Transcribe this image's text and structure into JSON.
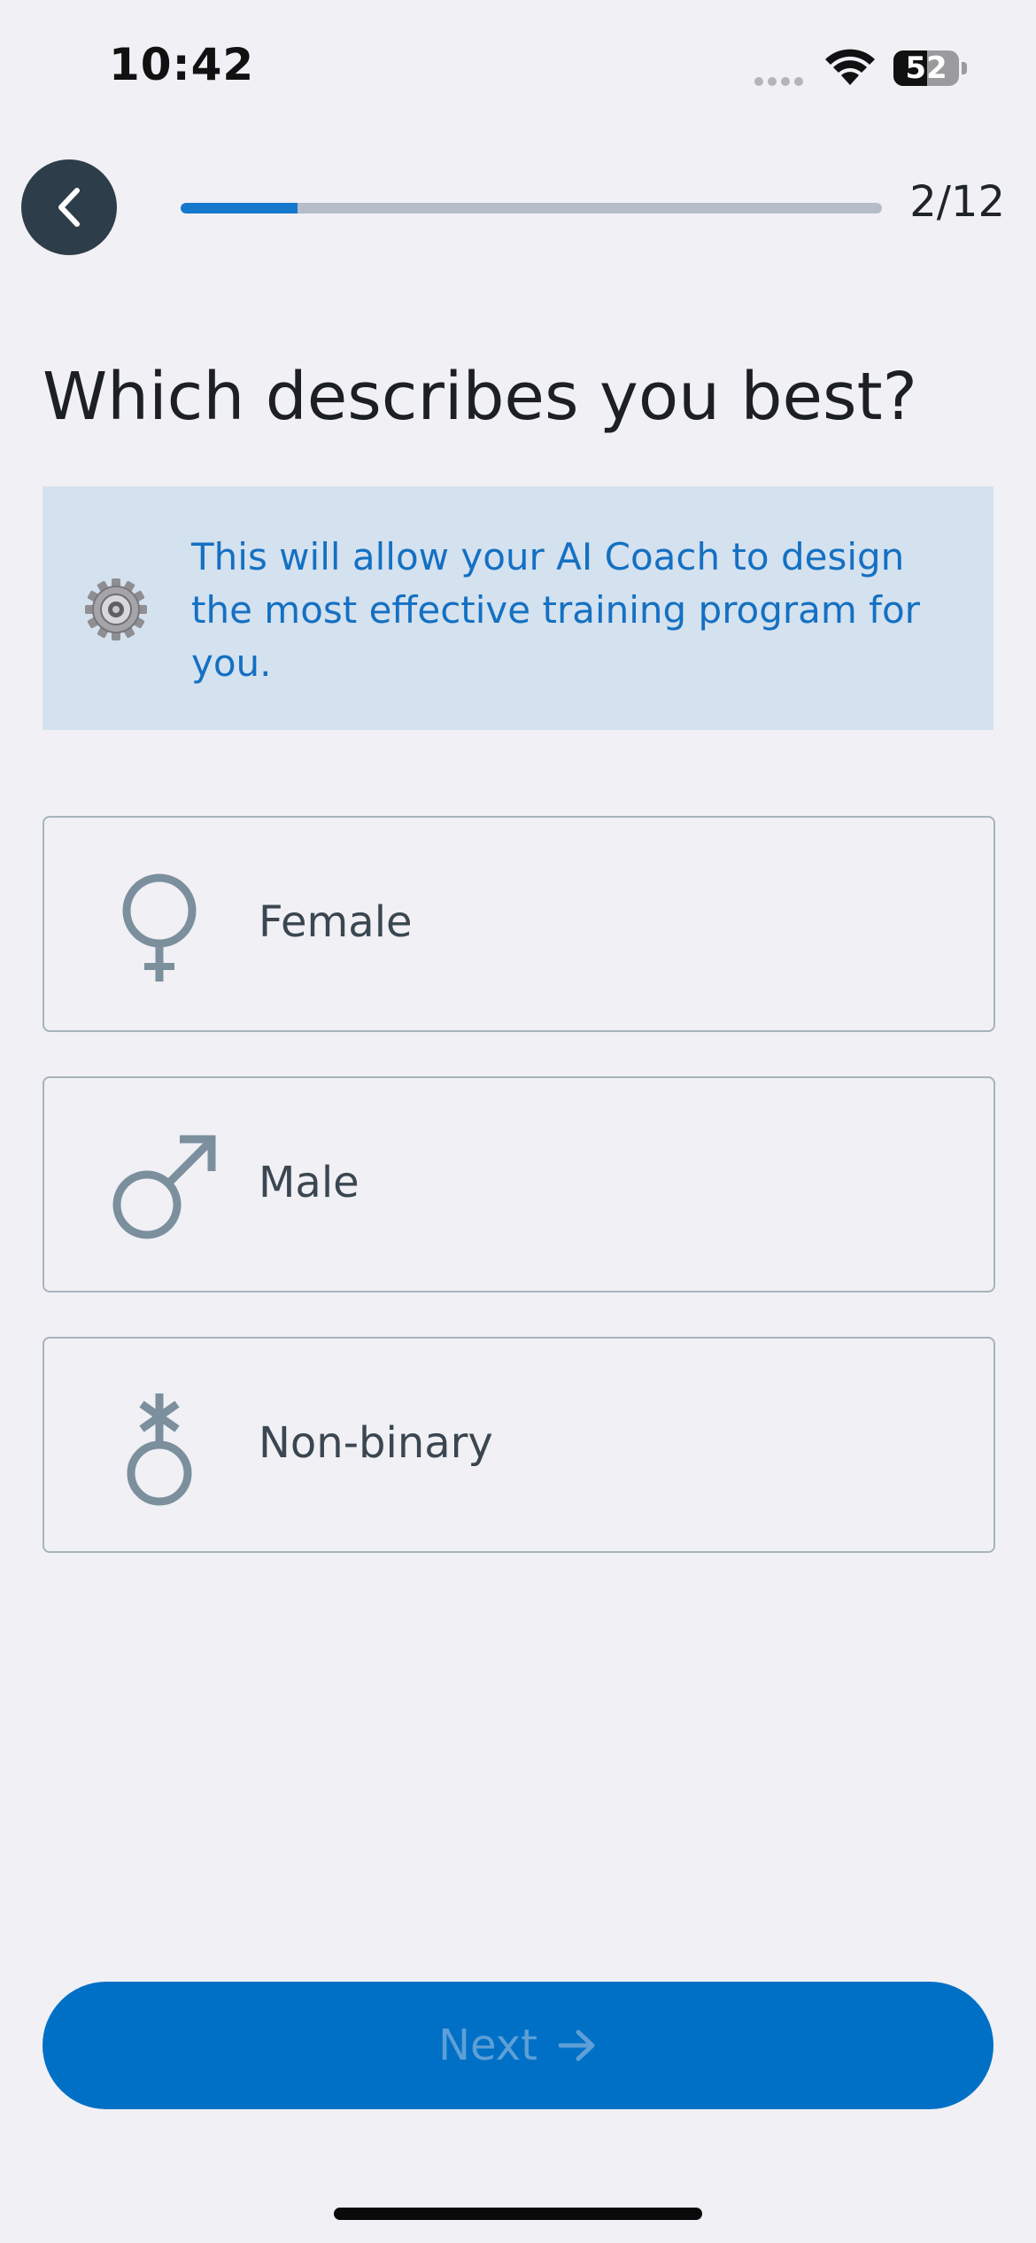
{
  "status_bar": {
    "time": "10:42",
    "battery_level": "52",
    "battery_fraction": 0.52
  },
  "header": {
    "back_icon": "chevron-left-icon",
    "progress_label": "2/12",
    "progress_fraction": 0.1667
  },
  "title": "Which describes you best?",
  "info": {
    "icon": "gear-icon",
    "text": "This will allow your AI Coach to design the most effective training program for you."
  },
  "options": [
    {
      "label": "Female",
      "icon": "female-symbol-icon"
    },
    {
      "label": "Male",
      "icon": "male-symbol-icon"
    },
    {
      "label": "Non-binary",
      "icon": "nonbinary-symbol-icon"
    }
  ],
  "next_button": {
    "label": "Next",
    "icon": "arrow-right-icon",
    "enabled": false
  },
  "colors": {
    "accent": "#0070C7",
    "progress_fill": "#1478CC",
    "info_background": "#D4E1EF",
    "info_text": "#1470C2",
    "option_icon": "#7B8F9D",
    "back_button": "#2D3D4A"
  }
}
